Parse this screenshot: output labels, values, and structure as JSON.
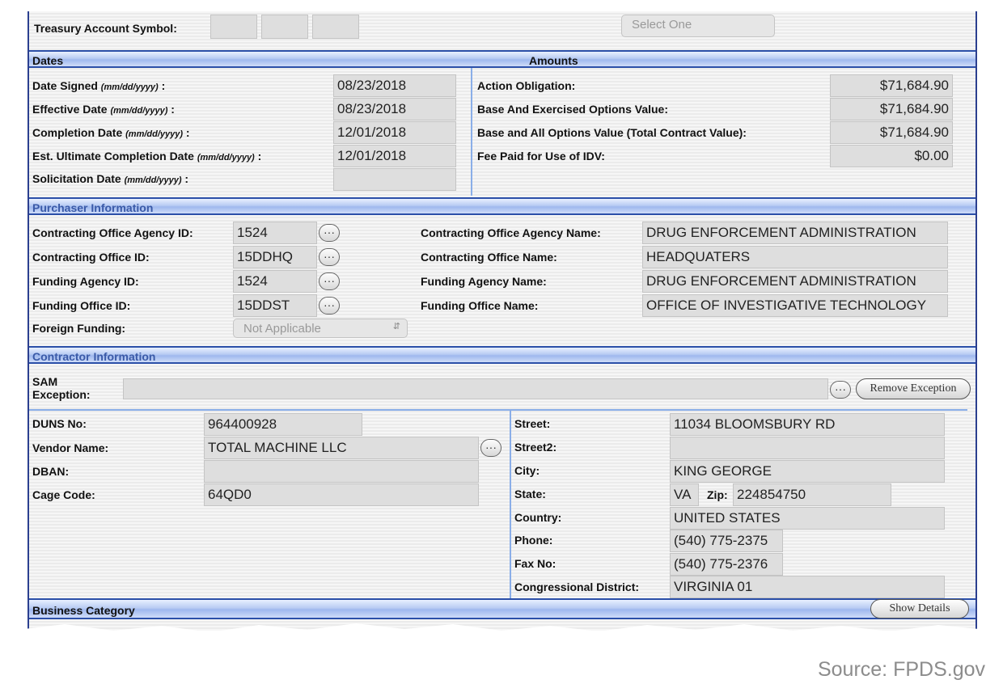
{
  "top": {
    "treasury_label": "Treasury Account Symbol:",
    "select_partial": "Select One"
  },
  "dates": {
    "header": "Dates",
    "date_signed": {
      "label": "Date Signed",
      "hint": "(mm/dd/yyyy)",
      "value": "08/23/2018"
    },
    "effective_date": {
      "label": "Effective Date",
      "hint": "(mm/dd/yyyy)",
      "value": "08/23/2018"
    },
    "completion_date": {
      "label": "Completion Date",
      "hint": "(mm/dd/yyyy)",
      "value": "12/01/2018"
    },
    "est_ultimate": {
      "label": "Est. Ultimate Completion Date",
      "hint": "(mm/dd/yyyy)",
      "value": "12/01/2018"
    },
    "solicitation_date": {
      "label": "Solicitation Date",
      "hint": "(mm/dd/yyyy)",
      "value": ""
    }
  },
  "amounts": {
    "header": "Amounts",
    "action_obligation": {
      "label": "Action Obligation:",
      "value": "$71,684.90"
    },
    "base_exercised": {
      "label": "Base And Exercised Options Value:",
      "value": "$71,684.90"
    },
    "base_all": {
      "label": "Base and All Options Value (Total Contract Value):",
      "value": "$71,684.90"
    },
    "fee_paid": {
      "label": "Fee Paid for Use of IDV:",
      "value": "$0.00"
    }
  },
  "purchaser": {
    "header": "Purchaser Information",
    "co_agency_id": {
      "label": "Contracting Office Agency ID:",
      "value": "1524"
    },
    "co_id": {
      "label": "Contracting Office ID:",
      "value": "15DDHQ"
    },
    "funding_agency_id": {
      "label": "Funding Agency ID:",
      "value": "1524"
    },
    "funding_office_id": {
      "label": "Funding Office ID:",
      "value": "15DDST"
    },
    "foreign_funding": {
      "label": "Foreign Funding:",
      "value": "Not Applicable"
    },
    "co_agency_name": {
      "label": "Contracting Office Agency Name:",
      "value": "DRUG ENFORCEMENT ADMINISTRATION"
    },
    "co_name": {
      "label": "Contracting Office Name:",
      "value": "HEADQUATERS"
    },
    "funding_agency_name": {
      "label": "Funding Agency Name:",
      "value": "DRUG ENFORCEMENT ADMINISTRATION"
    },
    "funding_office_name": {
      "label": "Funding Office Name:",
      "value": "OFFICE OF INVESTIGATIVE TECHNOLOGY"
    }
  },
  "contractor": {
    "header": "Contractor Information",
    "sam_label_1": "SAM",
    "sam_label_2": "Exception:",
    "sam_value": "",
    "remove_exception": "Remove Exception",
    "duns": {
      "label": "DUNS No:",
      "value": "964400928"
    },
    "vendor_name": {
      "label": "Vendor Name:",
      "value": "TOTAL MACHINE LLC"
    },
    "dban": {
      "label": "DBAN:",
      "value": ""
    },
    "cage_code": {
      "label": "Cage Code:",
      "value": "64QD0"
    },
    "street": {
      "label": "Street:",
      "value": "11034 BLOOMSBURY RD"
    },
    "street2": {
      "label": "Street2:",
      "value": ""
    },
    "city": {
      "label": "City:",
      "value": "KING GEORGE"
    },
    "state": {
      "label": "State:",
      "value": "VA"
    },
    "zip": {
      "label": "Zip:",
      "value": "224854750"
    },
    "country": {
      "label": "Country:",
      "value": "UNITED STATES"
    },
    "phone": {
      "label": "Phone:",
      "value": "(540) 775-2375"
    },
    "fax": {
      "label": "Fax No:",
      "value": "(540) 775-2376"
    },
    "district": {
      "label": "Congressional District:",
      "value": "VIRGINIA 01"
    }
  },
  "business": {
    "header": "Business Category",
    "show_details": "Show Details"
  },
  "ellipsis": "···",
  "source": "Source: FPDS.gov"
}
